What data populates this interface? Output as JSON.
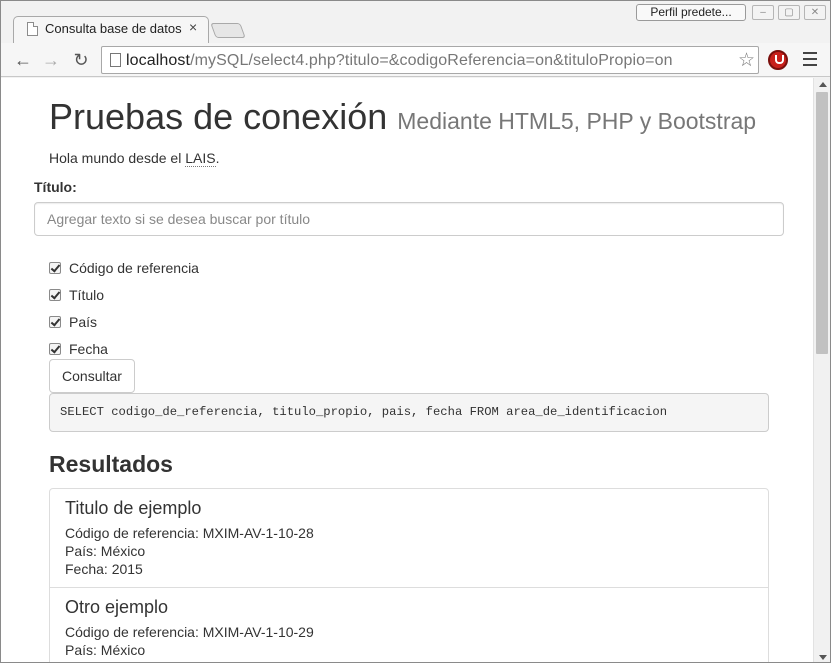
{
  "browser": {
    "tab_title": "Consulta base de datos",
    "tab_close": "×",
    "profile_button": "Perfil predete...",
    "url_host": "localhost",
    "url_path": "/mySQL/select4.php?titulo=&codigoReferencia=on&tituloPropio=on",
    "nav_back": "←",
    "nav_forward": "→",
    "nav_reload": "↻",
    "bookmark_star": "☆",
    "window_min": "–",
    "window_max": "▢",
    "window_close": "✕"
  },
  "page": {
    "heading": "Pruebas de conexión",
    "subheading": "Mediante HTML5, PHP y Bootstrap",
    "hello_prefix": "Hola mundo desde el ",
    "hello_abbr": "LAIS",
    "hello_suffix": "."
  },
  "form": {
    "title_label": "Título:",
    "title_input_value": "",
    "title_input_placeholder": "Agregar texto si se desea buscar por título",
    "checkboxes": [
      {
        "label": "Código de referencia",
        "checked": true
      },
      {
        "label": "Título",
        "checked": true
      },
      {
        "label": "País",
        "checked": true
      },
      {
        "label": "Fecha",
        "checked": true
      }
    ],
    "submit_label": "Consultar"
  },
  "query": "SELECT codigo_de_referencia, titulo_propio, pais, fecha FROM area_de_identificacion",
  "results": {
    "heading": "Resultados",
    "items": [
      {
        "title": "Titulo de ejemplo",
        "ref": "Código de referencia: MXIM-AV-1-10-28",
        "country": "País: México",
        "date": "Fecha: 2015"
      },
      {
        "title": "Otro ejemplo",
        "ref": "Código de referencia: MXIM-AV-1-10-29",
        "country": "País: México",
        "date": ""
      }
    ]
  }
}
